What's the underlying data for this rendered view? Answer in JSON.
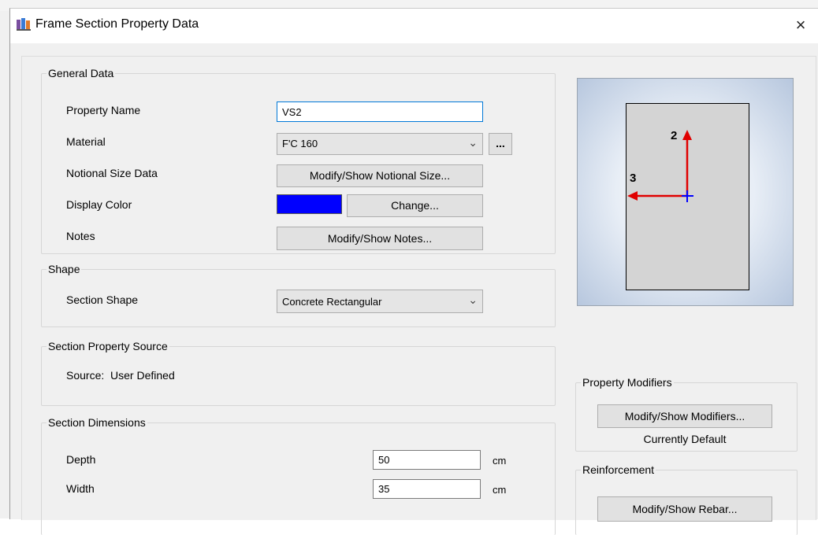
{
  "window": {
    "title": "Frame Section Property Data",
    "close_glyph": "×"
  },
  "general_data": {
    "legend": "General Data",
    "property_name_label": "Property Name",
    "property_name_value": "VS2",
    "material_label": "Material",
    "material_value": "F'C 160",
    "material_browse_label": "...",
    "notional_size_label": "Notional Size Data",
    "notional_size_button": "Modify/Show Notional Size...",
    "display_color_label": "Display Color",
    "display_color_value": "#0000ff",
    "change_button": "Change...",
    "notes_label": "Notes",
    "notes_button": "Modify/Show Notes..."
  },
  "shape": {
    "legend": "Shape",
    "section_shape_label": "Section Shape",
    "section_shape_value": "Concrete Rectangular"
  },
  "section_property_source": {
    "legend": "Section Property Source",
    "source_text": "Source:  User Defined"
  },
  "section_dimensions": {
    "legend": "Section Dimensions",
    "depth_label": "Depth",
    "depth_value": "50",
    "depth_unit": "cm",
    "width_label": "Width",
    "width_value": "35",
    "width_unit": "cm"
  },
  "preview": {
    "axis_2_label": "2",
    "axis_3_label": "3",
    "axis_color": "#e00000",
    "centroid_color": "#0000ff",
    "section_fill": "#d4d4d4"
  },
  "property_modifiers": {
    "legend": "Property Modifiers",
    "button": "Modify/Show Modifiers...",
    "status": "Currently Default"
  },
  "reinforcement": {
    "legend": "Reinforcement",
    "button": "Modify/Show Rebar..."
  },
  "icons": {
    "app": "frame-section-app-icon",
    "dropdown": "chevron-down-icon",
    "close": "close-icon"
  }
}
